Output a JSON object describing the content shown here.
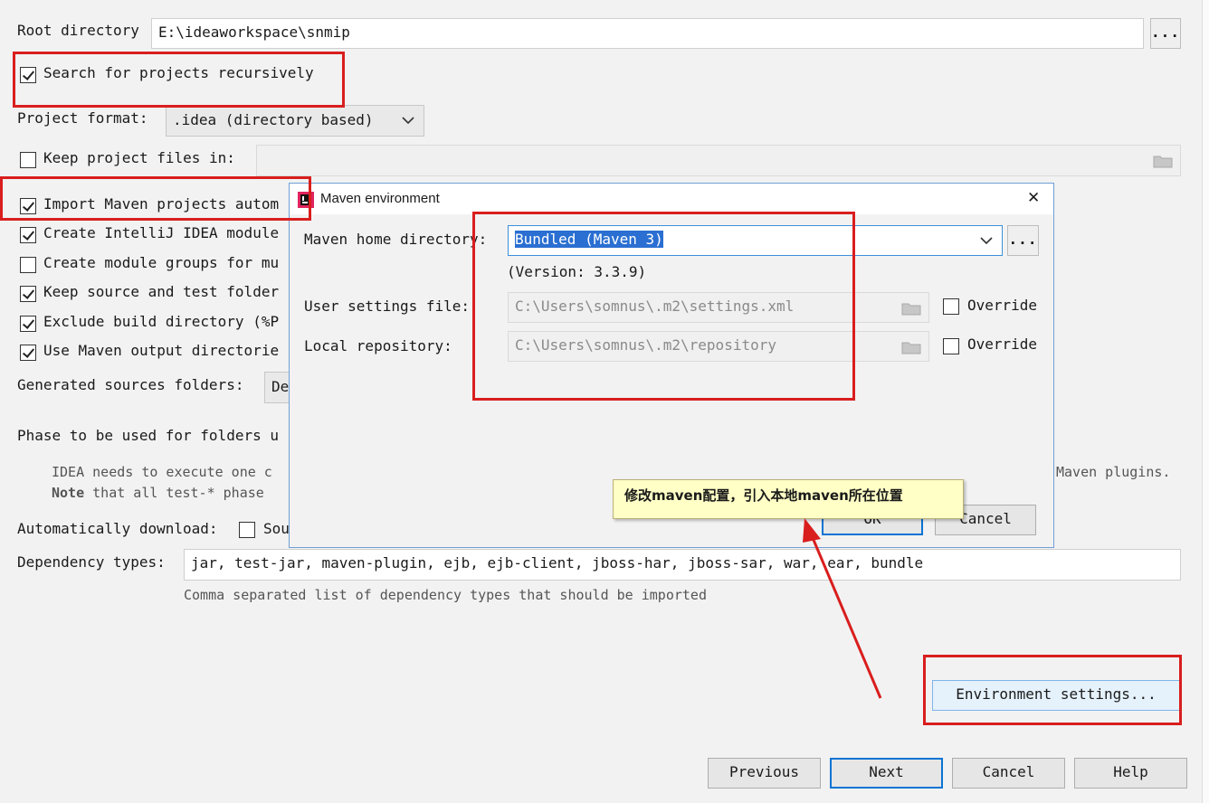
{
  "main": {
    "root_label": "Root directory",
    "root_value": "E:\\ideaworkspace\\snmip",
    "browse_label": "...",
    "search_recursive": {
      "label": "Search for projects recursively",
      "checked": true
    },
    "project_format_label": "Project format:",
    "project_format_value": ".idea (directory based)",
    "keep_files": {
      "label": "Keep project files in:",
      "checked": false
    },
    "options": [
      {
        "label": "Import Maven projects autom",
        "checked": true
      },
      {
        "label": "Create IntelliJ IDEA module",
        "checked": true
      },
      {
        "label": "Create module groups for mu",
        "checked": false
      },
      {
        "label": "Keep source and test folder",
        "checked": true
      },
      {
        "label": "Exclude build directory (%P",
        "checked": true
      },
      {
        "label": "Use Maven output directorie",
        "checked": true
      }
    ],
    "generated_sources_label": "Generated sources folders:",
    "generated_sources_value": "De",
    "phase_label": "Phase to be used for folders u",
    "info_line1": "IDEA needs to execute one c",
    "info_line1_right": "Maven plugins.",
    "info_note_bold": "Note",
    "info_line2": " that all test-* phase",
    "auto_download_label": "Automatically download:",
    "auto_download_option": "Sou",
    "dependency_types_label": "Dependency types:",
    "dependency_types_value": "jar, test-jar, maven-plugin, ejb, ejb-client, jboss-har, jboss-sar, war, ear, bundle",
    "dependency_hint": "Comma separated list of dependency types that should be imported",
    "env_settings_button": "Environment settings..."
  },
  "footer": {
    "previous": "Previous",
    "next": "Next",
    "cancel": "Cancel",
    "help": "Help"
  },
  "dialog": {
    "title": "Maven environment",
    "close_glyph": "✕",
    "maven_home_label": "Maven home directory:",
    "maven_home_value": "Bundled (Maven 3)",
    "version_text": "(Version: 3.3.9)",
    "user_settings_label": "User settings file:",
    "user_settings_value": "C:\\Users\\somnus\\.m2\\settings.xml",
    "local_repo_label": "Local repository:",
    "local_repo_value": "C:\\Users\\somnus\\.m2\\repository",
    "override_label": "Override",
    "ok_label": "OK",
    "cancel_label": "Cancel"
  },
  "annotation": {
    "note_text": "修改maven配置，引入本地maven所在位置",
    "accent_color": "#d91e1e"
  }
}
